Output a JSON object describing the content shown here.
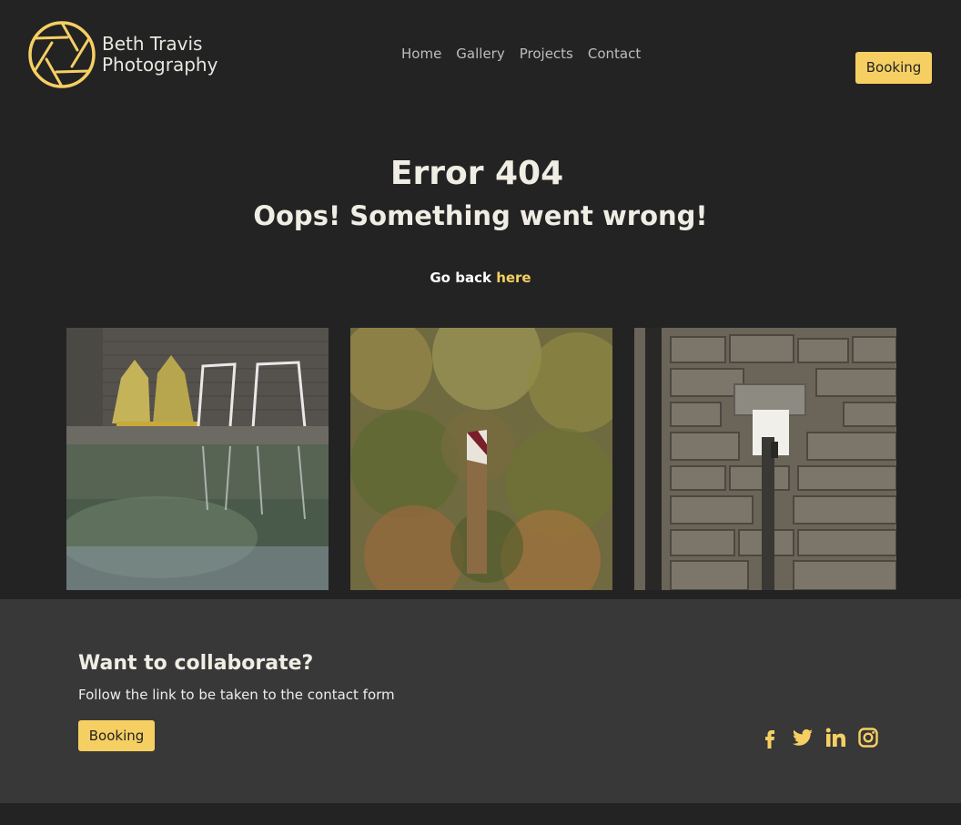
{
  "brand": {
    "line1": "Beth Travis",
    "line2": "Photography",
    "accent": "#f6cf63"
  },
  "nav": {
    "items": [
      "Home",
      "Gallery",
      "Projects",
      "Contact"
    ],
    "booking": "Booking"
  },
  "hero": {
    "title": "Error 404",
    "subtitle": "Oops! Something went wrong!",
    "go_back_prefix": "Go back",
    "go_back_link": "here"
  },
  "gallery": {
    "photos": [
      "tents-reflection-photo",
      "forest-signpost-photo",
      "stone-wall-plaque-photo"
    ]
  },
  "footer": {
    "heading": "Want to collaborate?",
    "text": "Follow the link to be taken to the contact form",
    "booking": "Booking",
    "social_icons": [
      "facebook-icon",
      "twitter-icon",
      "linkedin-icon",
      "instagram-icon"
    ]
  }
}
